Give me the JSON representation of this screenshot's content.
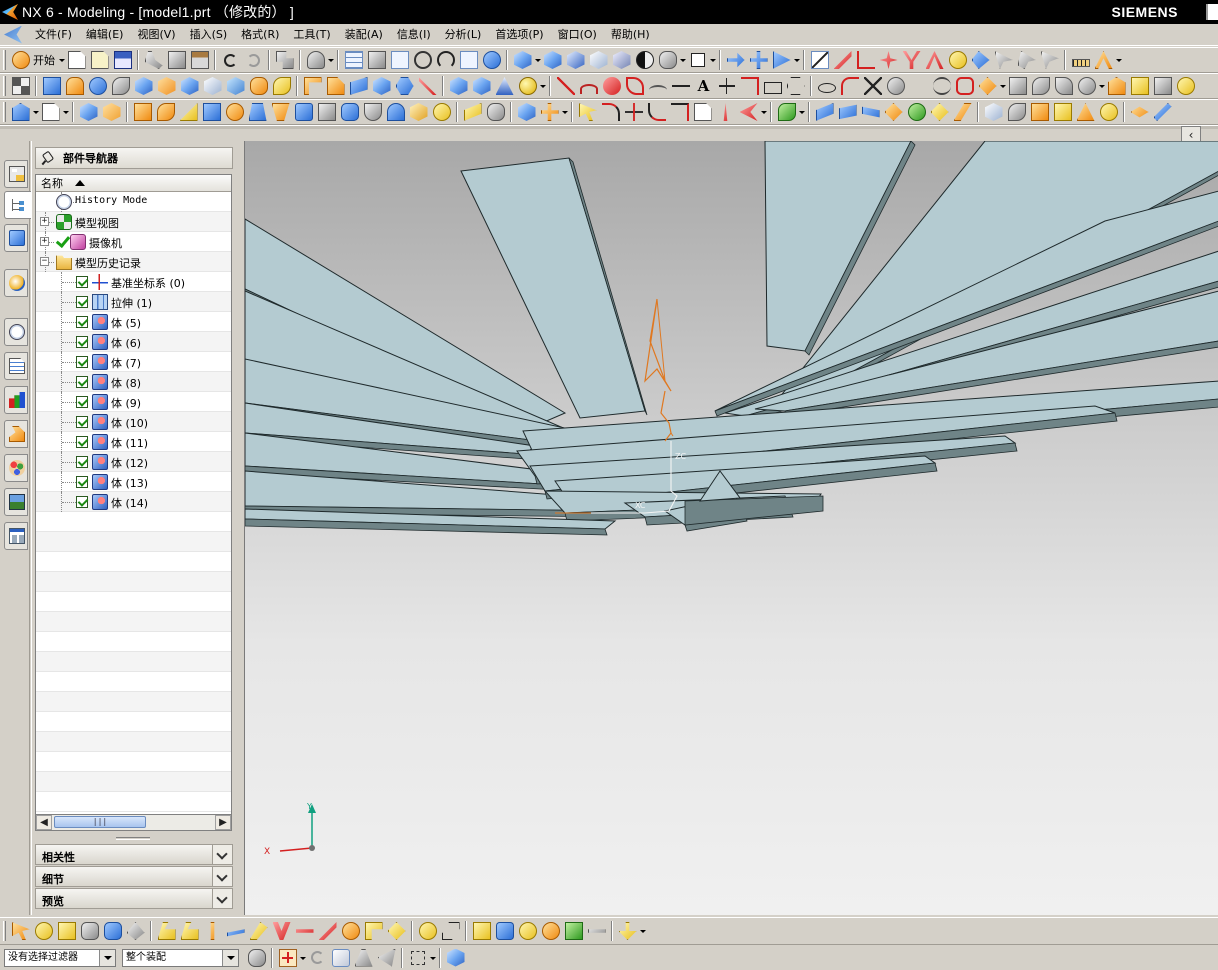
{
  "window": {
    "title": "NX 6 - Modeling - [model1.prt （修改的） ]",
    "brand": "SIEMENS"
  },
  "menu": {
    "items": [
      "文件(F)",
      "编辑(E)",
      "视图(V)",
      "插入(S)",
      "格式(R)",
      "工具(T)",
      "装配(A)",
      "信息(I)",
      "分析(L)",
      "首选项(P)",
      "窗口(O)",
      "帮助(H)"
    ]
  },
  "toolbar": {
    "start_label": "开始"
  },
  "navigator": {
    "title": "部件导航器",
    "column_header": "名称",
    "rows": [
      {
        "label": "History Mode",
        "icon": "clock-icon",
        "level": 1,
        "check": "none"
      },
      {
        "label": "模型视图",
        "icon": "model-view-icon",
        "level": 0,
        "check": "none"
      },
      {
        "label": "摄像机",
        "icon": "camera-icon",
        "level": 0,
        "check": "mark"
      },
      {
        "label": "模型历史记录",
        "icon": "folder-icon",
        "level": 0,
        "check": "none"
      },
      {
        "label": "基准坐标系 (0)",
        "icon": "datum-csys-icon",
        "level": 1,
        "check": "box"
      },
      {
        "label": "拉伸 (1)",
        "icon": "extrude-icon",
        "level": 1,
        "check": "box"
      },
      {
        "label": "体 (5)",
        "icon": "body-icon",
        "level": 1,
        "check": "box"
      },
      {
        "label": "体 (6)",
        "icon": "body-icon",
        "level": 1,
        "check": "box"
      },
      {
        "label": "体 (7)",
        "icon": "body-icon",
        "level": 1,
        "check": "box"
      },
      {
        "label": "体 (8)",
        "icon": "body-icon",
        "level": 1,
        "check": "box"
      },
      {
        "label": "体 (9)",
        "icon": "body-icon",
        "level": 1,
        "check": "box"
      },
      {
        "label": "体 (10)",
        "icon": "body-icon",
        "level": 1,
        "check": "box"
      },
      {
        "label": "体 (11)",
        "icon": "body-icon",
        "level": 1,
        "check": "box"
      },
      {
        "label": "体 (12)",
        "icon": "body-icon",
        "level": 1,
        "check": "box"
      },
      {
        "label": "体 (13)",
        "icon": "body-icon",
        "level": 1,
        "check": "box"
      },
      {
        "label": "体 (14)",
        "icon": "body-icon",
        "level": 1,
        "check": "box"
      }
    ],
    "sections": [
      "相关性",
      "细节",
      "预览"
    ]
  },
  "viewport": {
    "triad_x": "X",
    "triad_y": "Y",
    "triad_zc": "ZC",
    "triad_xc": "XC",
    "colors": {
      "plate_face": "#b4cbd1",
      "plate_edge": "#6f8487",
      "background_top": "#a8a8a8",
      "background_bottom": "#f0f0f0",
      "wcs_orange": "#e07820",
      "axis_x": "#d42020",
      "axis_y": "#10a080"
    }
  },
  "status": {
    "selection_filter": "没有选择过滤器",
    "scope": "整个装配"
  }
}
